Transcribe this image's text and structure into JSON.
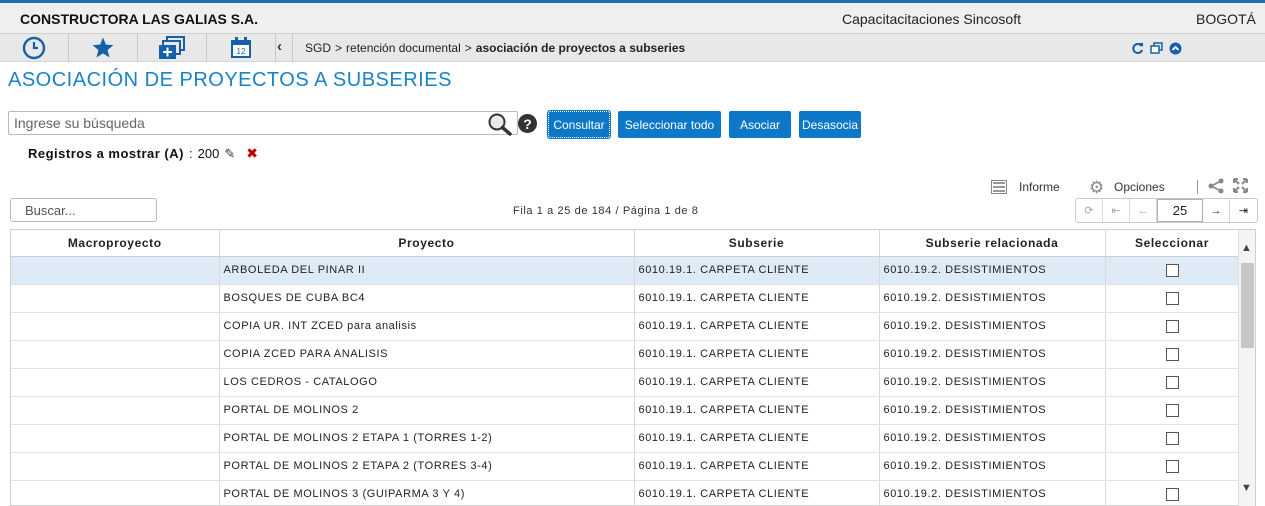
{
  "header": {
    "company": "CONSTRUCTORA LAS GALIAS S.A.",
    "tenant": "Capacitacitaciones Sincosoft",
    "city": "BOGOTÁ"
  },
  "nav": {
    "icons": [
      "clock-icon",
      "star-icon",
      "windows-add-icon",
      "calendar-icon"
    ],
    "calendar_day": "12",
    "breadcrumb": {
      "root": "SGD",
      "sep": ">",
      "middle": "retención documental",
      "current": "asociación de proyectos a subseries"
    }
  },
  "page": {
    "title": "ASOCIACIÓN DE PROYECTOS A SUBSERIES"
  },
  "search": {
    "placeholder": "Ingrese su búsqueda",
    "help": "?"
  },
  "actions": {
    "consultar": "Consultar",
    "seleccionar_todo": "Seleccionar todo",
    "asociar": "Asociar",
    "desasociar": "Desasocia"
  },
  "records": {
    "label": "Registros a mostrar (A)",
    "colon": ":",
    "value": "200"
  },
  "toolbar": {
    "informe": "Informe",
    "opciones": "Opciones"
  },
  "grid": {
    "search_placeholder": "Buscar...",
    "pager_info": "Fila 1 a 25 de 184 / Página 1 de 8",
    "page_size": "25",
    "columns": [
      "Macroproyecto",
      "Proyecto",
      "Subserie",
      "Subserie relacionada",
      "Seleccionar"
    ],
    "rows": [
      {
        "macro": "",
        "proyecto": "ARBOLEDA DEL PINAR II",
        "subserie": "6010.19.1. CARPETA CLIENTE",
        "relacionada": "6010.19.2. DESISTIMIENTOS"
      },
      {
        "macro": "",
        "proyecto": "BOSQUES DE CUBA BC4",
        "subserie": "6010.19.1. CARPETA CLIENTE",
        "relacionada": "6010.19.2. DESISTIMIENTOS"
      },
      {
        "macro": "",
        "proyecto": "COPIA UR. INT ZCED para analisis",
        "subserie": "6010.19.1. CARPETA CLIENTE",
        "relacionada": "6010.19.2. DESISTIMIENTOS"
      },
      {
        "macro": "",
        "proyecto": "COPIA ZCED PARA ANALISIS",
        "subserie": "6010.19.1. CARPETA CLIENTE",
        "relacionada": "6010.19.2. DESISTIMIENTOS"
      },
      {
        "macro": "",
        "proyecto": "LOS CEDROS - CATALOGO",
        "subserie": "6010.19.1. CARPETA CLIENTE",
        "relacionada": "6010.19.2. DESISTIMIENTOS"
      },
      {
        "macro": "",
        "proyecto": "PORTAL DE MOLINOS 2",
        "subserie": "6010.19.1. CARPETA CLIENTE",
        "relacionada": "6010.19.2. DESISTIMIENTOS"
      },
      {
        "macro": "",
        "proyecto": "PORTAL DE MOLINOS 2 ETAPA 1 (TORRES 1-2)",
        "subserie": "6010.19.1. CARPETA CLIENTE",
        "relacionada": "6010.19.2. DESISTIMIENTOS"
      },
      {
        "macro": "",
        "proyecto": "PORTAL DE MOLINOS 2 ETAPA 2 (TORRES 3-4)",
        "subserie": "6010.19.1. CARPETA CLIENTE",
        "relacionada": "6010.19.2. DESISTIMIENTOS"
      },
      {
        "macro": "",
        "proyecto": "PORTAL DE MOLINOS 3 (GUIPARMA 3 Y 4)",
        "subserie": "6010.19.1. CARPETA CLIENTE",
        "relacionada": "6010.19.2. DESISTIMIENTOS"
      }
    ]
  },
  "colors": {
    "accent": "#1a83c6",
    "button": "#0d78c8",
    "selected_row": "#dfeaf7",
    "top_border": "#1b6fb5"
  }
}
